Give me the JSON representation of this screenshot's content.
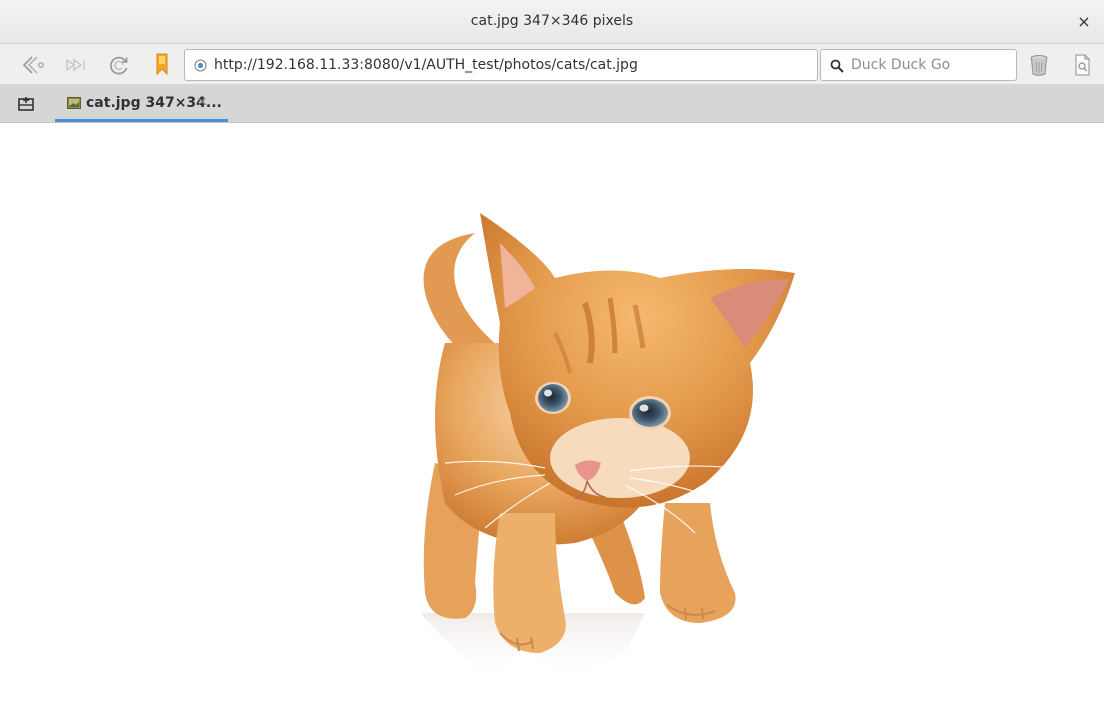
{
  "window": {
    "title": "cat.jpg 347×346 pixels",
    "close_glyph": "×"
  },
  "toolbar": {
    "buttons": [
      {
        "name": "back-button",
        "icon": "back-arrow-icon"
      },
      {
        "name": "forward-button",
        "icon": "forward-arrow-icon"
      },
      {
        "name": "reload-button",
        "icon": "reload-icon"
      },
      {
        "name": "bookmark-button",
        "icon": "bookmark-icon"
      },
      {
        "name": "trash-button",
        "icon": "trash-icon"
      },
      {
        "name": "page-menu-button",
        "icon": "page-icon"
      }
    ],
    "address": {
      "url": "http://192.168.11.33:8080/v1/AUTH_test/photos/cats/cat.jpg",
      "icon": "globe-icon"
    },
    "search": {
      "placeholder": "Duck Duck Go",
      "icon": "search-icon"
    }
  },
  "tabs": [
    {
      "label": "cat.jpg 347×34...",
      "close_glyph": "×",
      "active": true,
      "favicon": "image-icon"
    }
  ],
  "content": {
    "image_description": "orange-kitten-photo"
  },
  "colors": {
    "accent": "#4a90d9",
    "bookmark": "#f5a623"
  }
}
